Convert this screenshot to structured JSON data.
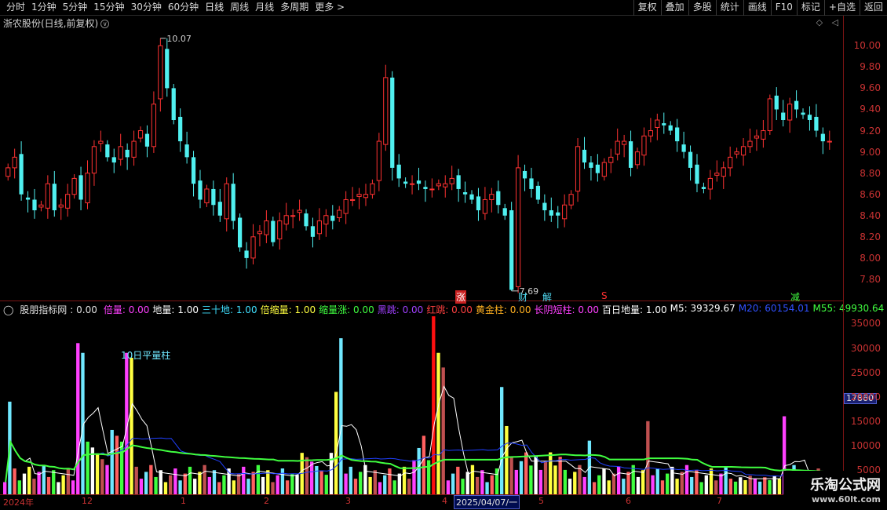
{
  "toolbar": {
    "periods": [
      "分时",
      "1分钟",
      "5分钟",
      "15分钟",
      "30分钟",
      "60分钟",
      "日线",
      "周线",
      "月线",
      "多周期",
      "更多 >"
    ],
    "active_period": "日线",
    "right_buttons": [
      "复权",
      "叠加",
      "多股",
      "统计",
      "画线",
      "F10",
      "标记",
      "+自选",
      "返回"
    ]
  },
  "price_panel": {
    "title": "浙农股份(日线,前复权)",
    "title_icon": "chevron-down-icon",
    "controls": "◇ ◁",
    "high_label": "10.07",
    "low_label": "7.69",
    "y_ticks": [
      "10.00",
      "9.80",
      "9.60",
      "9.40",
      "9.20",
      "9.00",
      "8.80",
      "8.60",
      "8.40",
      "8.20",
      "8.00",
      "7.80"
    ],
    "markers": [
      {
        "text": "涨",
        "color": "#ffffff",
        "bg": "#c82020"
      },
      {
        "text": "财",
        "color": "#50d8f0"
      },
      {
        "text": "解",
        "color": "#50d8f0"
      },
      {
        "text": "S",
        "color": "#ff3030"
      },
      {
        "text": "减",
        "color": "#40ff40"
      }
    ]
  },
  "indicator": {
    "name": "股朋指标网",
    "value": ": 0.00",
    "fields": [
      {
        "label": "倍量: 0.00",
        "color": "#ff40ff"
      },
      {
        "label": "地量: 1.00",
        "color": "#ffffff"
      },
      {
        "label": "三十地: 1.00",
        "color": "#40e0ff"
      },
      {
        "label": "倍缩量: 1.00",
        "color": "#ffff40"
      },
      {
        "label": "缩量涨: 0.00",
        "color": "#40ff40"
      },
      {
        "label": "黑跳: 0.00",
        "color": "#a040ff"
      },
      {
        "label": "红跳: 0.00",
        "color": "#ff4040"
      },
      {
        "label": "黄金柱: 0.00",
        "color": "#ffb020"
      },
      {
        "label": "长阴短柱: 0.00",
        "color": "#ff40ff"
      },
      {
        "label": "百日地量: 1.00",
        "color": "#ffffff"
      },
      {
        "label": "M5: 39329.67",
        "color": "#ffffff"
      },
      {
        "label": "M20: 60154.01",
        "color": "#3050ff"
      },
      {
        "label": "M55: 49930.64",
        "color": "#40ff40"
      }
    ],
    "annotation": "10日平量柱",
    "y_ticks": [
      "35000",
      "30000",
      "25000",
      "20000",
      "15000",
      "10000",
      "5000"
    ],
    "current_value": "17860"
  },
  "date_axis": {
    "labels": [
      "2024年",
      "12",
      "1",
      "2",
      "3",
      "4",
      "5",
      "6",
      "7"
    ],
    "selected_date": "2025/04/07/一"
  },
  "watermark": {
    "title": "乐淘公式网",
    "url": "www.60lt.com"
  },
  "colors": {
    "up": "#ff3232",
    "down": "#50f0f0",
    "axis": "#c83232",
    "bg": "#000000"
  },
  "chart_data": [
    {
      "type": "candlestick",
      "title": "浙农股份(日线,前复权)",
      "ylim": [
        7.6,
        10.15
      ],
      "high": 10.07,
      "low": 7.69,
      "close": [
        8.85,
        8.95,
        8.6,
        8.55,
        8.45,
        8.5,
        8.7,
        8.45,
        8.5,
        8.6,
        8.75,
        8.55,
        8.8,
        9.05,
        9.1,
        8.95,
        8.9,
        9.05,
        8.95,
        9.1,
        9.2,
        9.05,
        9.45,
        10.0,
        9.6,
        9.3,
        9.1,
        8.95,
        8.7,
        8.55,
        8.65,
        8.5,
        8.4,
        8.7,
        8.35,
        8.1,
        8.0,
        8.2,
        8.25,
        8.35,
        8.15,
        8.35,
        8.4,
        8.4,
        8.45,
        8.3,
        8.2,
        8.35,
        8.4,
        8.35,
        8.45,
        8.55,
        8.55,
        8.6,
        8.6,
        8.7,
        9.1,
        9.7,
        8.85,
        8.75,
        8.7,
        8.7,
        8.7,
        8.65,
        8.65,
        8.7,
        8.7,
        8.75,
        8.65,
        8.6,
        8.55,
        8.45,
        8.55,
        8.6,
        8.5,
        8.4,
        7.7,
        8.85,
        8.75,
        8.65,
        8.55,
        8.45,
        8.4,
        8.4,
        8.5,
        8.6,
        9.05,
        8.9,
        8.85,
        8.8,
        8.9,
        8.95,
        9.1,
        9.1,
        8.85,
        9.0,
        9.15,
        9.2,
        9.3,
        9.25,
        9.2,
        9.1,
        9.0,
        8.85,
        8.7,
        8.65,
        8.75,
        8.8,
        8.85,
        8.95,
        9.0,
        9.05,
        9.1,
        9.15,
        9.2,
        9.5,
        9.4,
        9.3,
        9.45,
        9.4,
        9.35,
        9.3,
        9.2,
        9.1,
        9.1
      ]
    },
    {
      "type": "bar",
      "title": "股朋指标网",
      "ylim": [
        0,
        37000
      ],
      "series": [
        {
          "name": "M5",
          "values": [
            39329.67
          ]
        },
        {
          "name": "M20",
          "values": [
            60154.01
          ]
        },
        {
          "name": "M55",
          "values": [
            49930.64
          ]
        }
      ]
    }
  ]
}
